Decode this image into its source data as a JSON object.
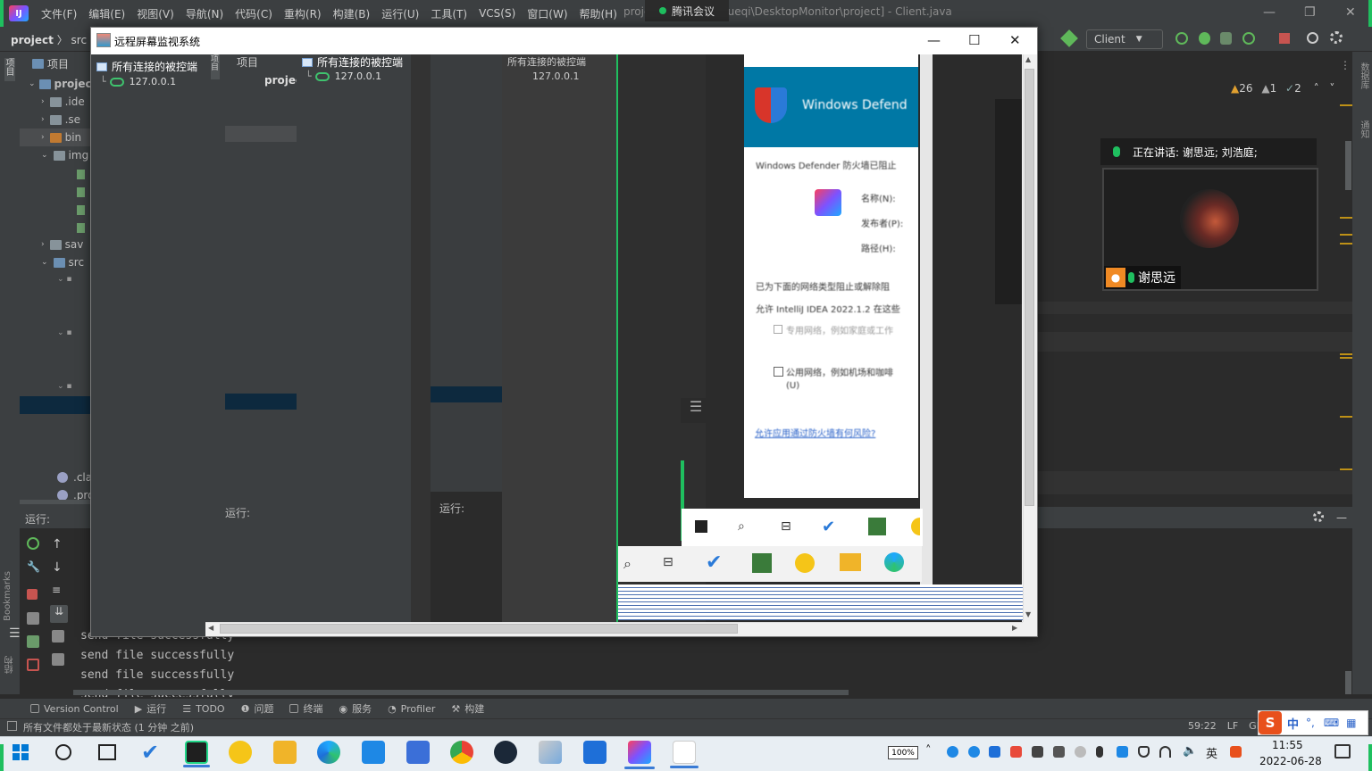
{
  "ide": {
    "menu": [
      "文件(F)",
      "编辑(E)",
      "视图(V)",
      "导航(N)",
      "代码(C)",
      "重构(R)",
      "构建(B)",
      "运行(U)",
      "工具(T)",
      "VCS(S)",
      "窗口(W)",
      "帮助(H)"
    ],
    "window_title": "proje... roject\\Xiaoxueqi\\DesktopMonitor\\project] - Client.java",
    "breadcrumb": {
      "project": "project",
      "src": "src"
    },
    "project_label": "项目",
    "run_config": "Client",
    "tree": [
      {
        "label": "projec",
        "type": "module"
      },
      {
        "label": ".ide",
        "type": "folder"
      },
      {
        "label": ".se",
        "type": "folder"
      },
      {
        "label": "bin",
        "type": "folder-excluded"
      },
      {
        "label": "img",
        "type": "folder"
      },
      {
        "label": "sav",
        "type": "folder"
      },
      {
        "label": "src",
        "type": "folder-src"
      },
      {
        "label": ".cla",
        "type": "file"
      },
      {
        "label": ".pro",
        "type": "file"
      }
    ],
    "warnings": {
      "warn": "26",
      "weak": "1",
      "ok": "2"
    },
    "run_label": "运行:",
    "console_lines": [
      "send file successfully",
      "send file successfully",
      "send file successfully",
      "send file successfully"
    ],
    "tool_tabs": [
      "Version Control",
      "运行",
      "TODO",
      "问题",
      "终端",
      "服务",
      "Profiler",
      "构建"
    ],
    "status_text": "所有文件都处于最新状态 (1 分钟 之前)",
    "caret": "59:22",
    "line_sep": "LF",
    "encoding": "GE",
    "bookmarks": "Bookmarks",
    "structure_tab": "结构",
    "db_tab": "数据库",
    "notify_tab": "通知"
  },
  "tencent": {
    "tab_label": "腾讯会议",
    "speaking": "正在讲话: 谢思远; 刘浩庭;",
    "participant": "谢思远"
  },
  "remote": {
    "title": "远程屏幕监视系统",
    "tree_root": "所有连接的被控端",
    "client_ip": "127.0.0.1",
    "nested_project_label": "项目",
    "nested_project": "projec",
    "nested_run_label": "运行:",
    "defender": {
      "header": "Windows Defend",
      "line1": "Windows Defender 防火墙已阻止",
      "name": "名称(N):",
      "publisher": "发布者(P):",
      "path": "路径(H):",
      "blocked": "已为下面的网络类型阻止或解除阻",
      "allow": "允许 IntelliJ IDEA 2022.1.2 在这些",
      "private": "专用网络，例如家庭或工作",
      "public": "公用网络，例如机场和咖啡",
      "public2": "(U)",
      "link": "允许应用通过防火墙有何风险?"
    }
  },
  "taskbar": {
    "battery": "100%",
    "time": "11:55",
    "date": "2022-06-28"
  },
  "ime": {
    "brand": "S",
    "lang": "中"
  }
}
